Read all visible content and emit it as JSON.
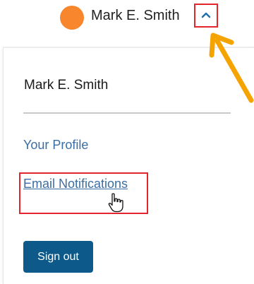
{
  "header": {
    "user_name": "Mark E. Smith",
    "avatar_color": "#f7862d",
    "toggle_icon": "chevron-up-icon"
  },
  "dropdown": {
    "user_name": "Mark E. Smith",
    "items": [
      {
        "label": "Your Profile"
      },
      {
        "label": "Email Notifications"
      }
    ],
    "signout_label": "Sign out"
  },
  "colors": {
    "highlight": "#e3262b",
    "link": "#3a6ea5",
    "button": "#0d5a8a",
    "arrow": "#f5a300"
  }
}
